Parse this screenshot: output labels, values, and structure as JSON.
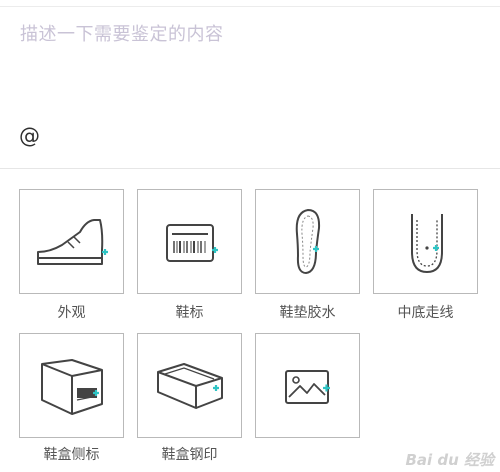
{
  "form": {
    "description_placeholder": "描述一下需要鉴定的内容",
    "mention_symbol": "@"
  },
  "tiles": [
    {
      "label": "外观",
      "icon": "sneaker-icon"
    },
    {
      "label": "鞋标",
      "icon": "barcode-tag-icon"
    },
    {
      "label": "鞋垫胶水",
      "icon": "insole-icon"
    },
    {
      "label": "中底走线",
      "icon": "midsole-stitching-icon"
    },
    {
      "label": "鞋盒侧标",
      "icon": "shoebox-side-label-icon"
    },
    {
      "label": "鞋盒钢印",
      "icon": "shoebox-stamp-icon"
    },
    {
      "label": "",
      "icon": "image-upload-icon"
    }
  ],
  "watermark": "Bai du 经验",
  "colors": {
    "accent": "#2ec4c4",
    "icon_stroke": "#444444",
    "placeholder": "#c9c3d6"
  }
}
